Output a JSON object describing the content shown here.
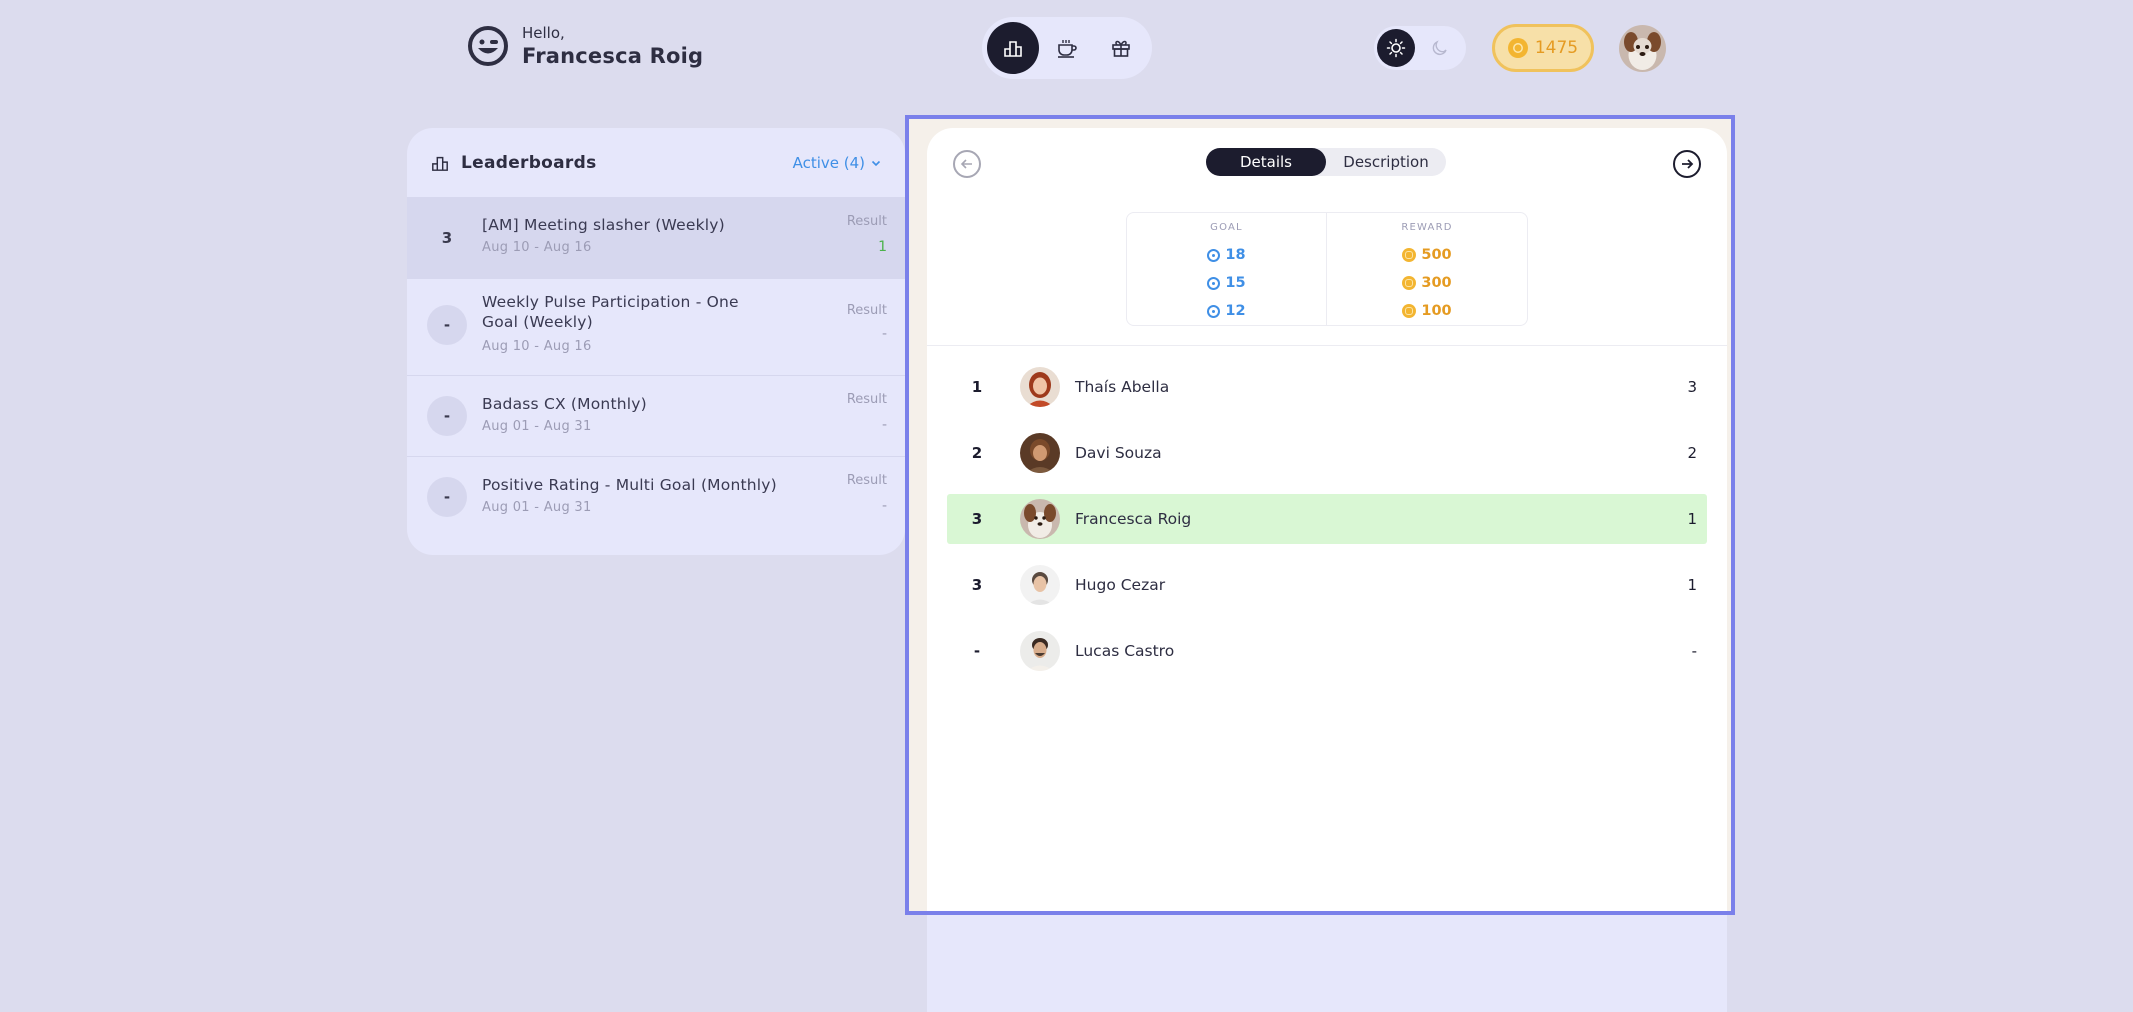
{
  "header": {
    "greeting": "Hello,",
    "user_name": "Francesca Roig",
    "nav": [
      {
        "icon": "leaderboard-icon",
        "active": true
      },
      {
        "icon": "coffee-icon",
        "active": false
      },
      {
        "icon": "gift-icon",
        "active": false
      }
    ],
    "theme": {
      "light_icon": "sun-icon",
      "dark_icon": "moon-icon",
      "selected": "light"
    },
    "coins": "1475"
  },
  "leaderboards": {
    "title": "Leaderboards",
    "filter_label": "Active (4)",
    "result_label": "Result",
    "items": [
      {
        "rank": "3",
        "name": "[AM] Meeting slasher (Weekly)",
        "dates": "Aug 10 - Aug 16",
        "result": "1",
        "selected": true
      },
      {
        "rank": "-",
        "name": "Weekly Pulse Participation - One Goal (Weekly)",
        "dates": "Aug 10 - Aug 16",
        "result": "-",
        "selected": false
      },
      {
        "rank": "-",
        "name": "Badass CX (Monthly)",
        "dates": "Aug 01 - Aug 31",
        "result": "-",
        "selected": false
      },
      {
        "rank": "-",
        "name": "Positive Rating - Multi Goal (Monthly)",
        "dates": "Aug 01 - Aug 31",
        "result": "-",
        "selected": false
      }
    ]
  },
  "detail": {
    "tabs": {
      "details": "Details",
      "description": "Description"
    },
    "goal_header": "GOAL",
    "reward_header": "REWARD",
    "tiers": [
      {
        "goal": "18",
        "reward": "500"
      },
      {
        "goal": "15",
        "reward": "300"
      },
      {
        "goal": "12",
        "reward": "100"
      }
    ],
    "ranking": [
      {
        "rank": "1",
        "name": "Thaís Abella",
        "score": "3",
        "highlight": false
      },
      {
        "rank": "2",
        "name": "Davi Souza",
        "score": "2",
        "highlight": false
      },
      {
        "rank": "3",
        "name": "Francesca Roig",
        "score": "1",
        "highlight": true
      },
      {
        "rank": "3",
        "name": "Hugo Cezar",
        "score": "1",
        "highlight": false
      },
      {
        "rank": "-",
        "name": "Lucas Castro",
        "score": "-",
        "highlight": false
      }
    ]
  },
  "colors": {
    "background": "#dcdcee",
    "panel": "#e6e7fb",
    "accent_blue": "#3f8fe6",
    "coin_orange": "#e59b22",
    "highlight_green": "#d9f7d4",
    "dark": "#1c1c2e",
    "frame": "#7a80ea"
  }
}
